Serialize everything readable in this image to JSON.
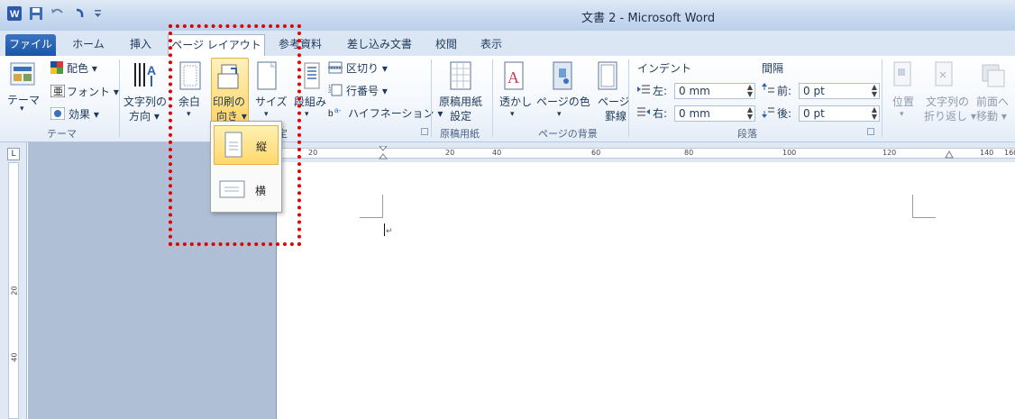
{
  "title_bar": {
    "title": "文書 2 - Microsoft Word"
  },
  "tabs": [
    {
      "label": "ファイル",
      "id": "file"
    },
    {
      "label": "ホーム",
      "id": "home"
    },
    {
      "label": "挿入",
      "id": "insert"
    },
    {
      "label": "ページ レイアウト",
      "id": "page-layout",
      "active": true
    },
    {
      "label": "参考資料",
      "id": "references"
    },
    {
      "label": "差し込み文書",
      "id": "mailings"
    },
    {
      "label": "校閲",
      "id": "review"
    },
    {
      "label": "表示",
      "id": "view"
    }
  ],
  "ribbon": {
    "theme": {
      "themes": "テーマ",
      "colors": "配色 ▾",
      "fonts": "フォント ▾",
      "effects": "効果 ▾",
      "group": "テーマ",
      "themes_arrow": "▾"
    },
    "page_setup": {
      "text_direction_1": "文字列の",
      "text_direction_2": "方向 ▾",
      "margins": "余白",
      "margins_arrow": "▾",
      "orientation_1": "印刷の",
      "orientation_2": "向き ▾",
      "size": "サイズ",
      "size_arrow": "▾",
      "columns": "段組み",
      "columns_arrow": "▾",
      "breaks": "区切り ▾",
      "line_numbers": "行番号 ▾",
      "hyphenation": "ハイフネーション ▾",
      "group_partial": "定"
    },
    "genko": {
      "label_1": "原稿用紙",
      "label_2": "設定",
      "group": "原稿用紙"
    },
    "page_background": {
      "watermark": "透かし",
      "watermark_arrow": "▾",
      "page_color": "ページの色",
      "page_color_arrow": "▾",
      "page_borders_1": "ページ",
      "page_borders_2": "罫線",
      "group": "ページの背景"
    },
    "paragraph": {
      "indent": "インデント",
      "spacing": "間隔",
      "left_label": "左:",
      "left_value": "0 mm",
      "right_label": "右:",
      "right_value": "0 mm",
      "before_label": "前:",
      "before_value": "0 pt",
      "after_label": "後:",
      "after_value": "0 pt",
      "group": "段落"
    },
    "arrange": {
      "position": "位置",
      "position_arrow": "▾",
      "wrap_1": "文字列の",
      "wrap_2": "折り返し ▾",
      "forward_1": "前面へ",
      "forward_2": "移動 ▾"
    }
  },
  "orientation_menu": {
    "portrait": "縦",
    "landscape": "横"
  },
  "hruler_ticks": [
    "20",
    "20",
    "40",
    "60",
    "80",
    "100",
    "120",
    "140",
    "160"
  ],
  "vruler_ticks": [
    "20",
    "40"
  ],
  "colors": {
    "highlight": "#e30000",
    "file_tab": "#2a62b3",
    "selected_option": "#ffd86a"
  }
}
